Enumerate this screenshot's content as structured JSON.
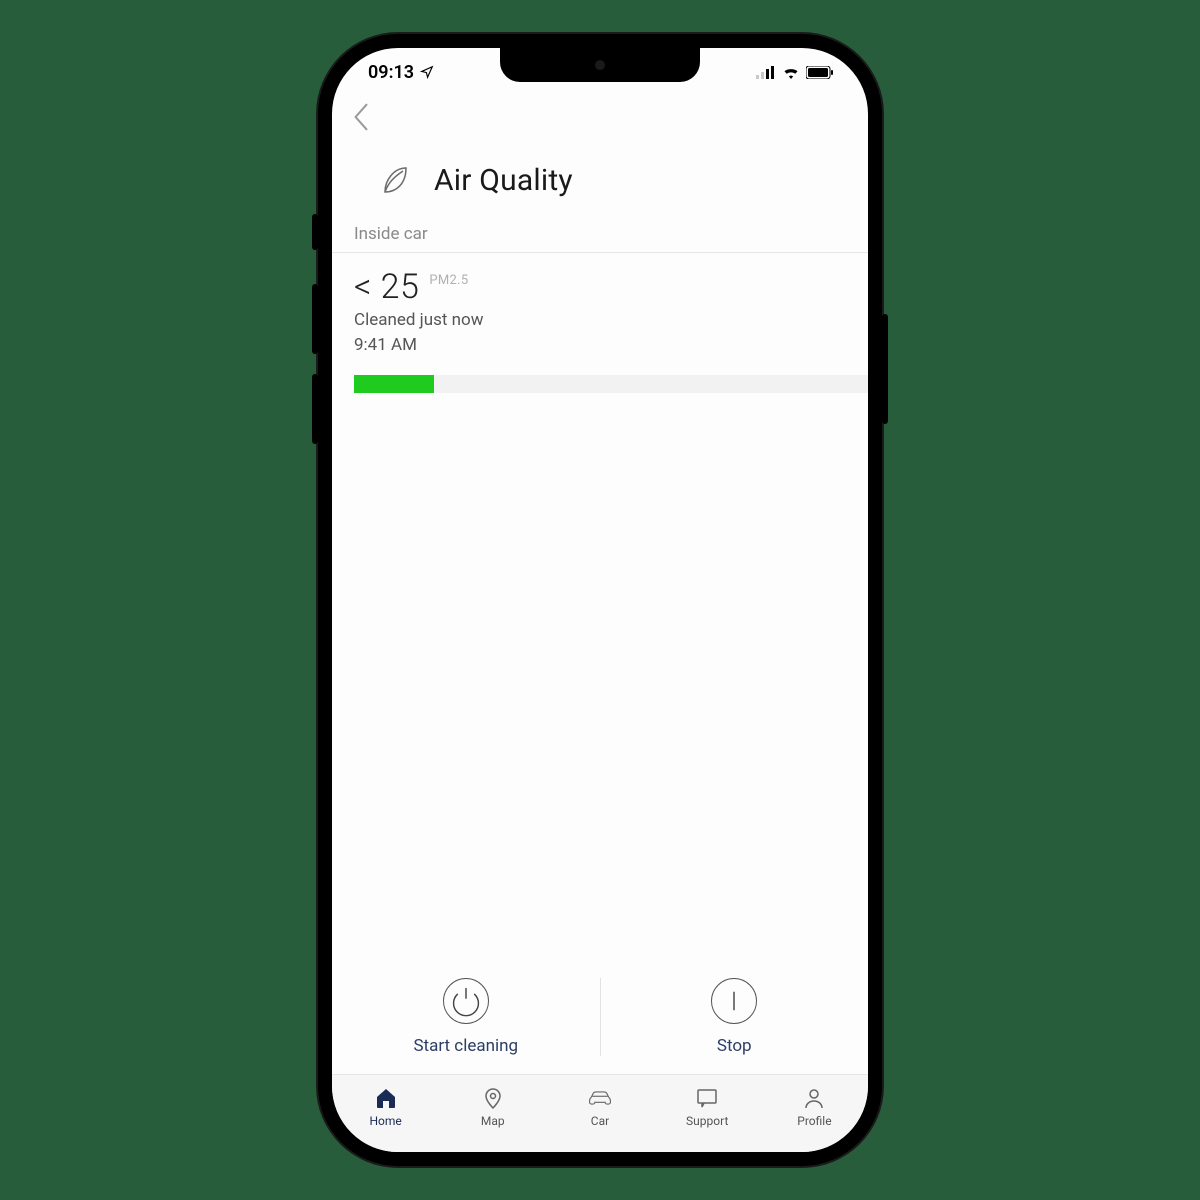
{
  "status": {
    "time": "09:13"
  },
  "header": {
    "title": "Air Quality"
  },
  "section": {
    "label": "Inside car"
  },
  "reading": {
    "value": "< 25",
    "unit": "PM2.5",
    "cleaned": "Cleaned just now",
    "time": "9:41 AM",
    "progress_percent": 15,
    "progress_color": "#1ecb1e"
  },
  "actions": {
    "start": "Start cleaning",
    "stop": "Stop"
  },
  "tabs": {
    "home": "Home",
    "map": "Map",
    "car": "Car",
    "support": "Support",
    "profile": "Profile"
  }
}
